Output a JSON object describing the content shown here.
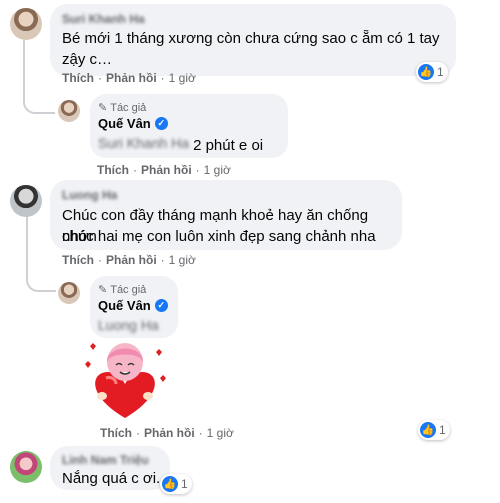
{
  "comments": [
    {
      "author": "Suri Khanh Ha",
      "text_line1": "Bé mới 1 tháng xương còn chưa cứng sao c ẵm có 1 tay",
      "text_line2": "zậy c…",
      "like_label": "Thích",
      "reply_label": "Phản hồi",
      "time": "1 giờ",
      "reaction_count": "1",
      "reply": {
        "badge": "Tác giả",
        "author": "Quế Vân",
        "mention": "Suri Khanh Ha",
        "text": "2 phút e oi",
        "like_label": "Thích",
        "reply_label": "Phản hồi",
        "time": "1 giờ"
      }
    },
    {
      "author": "Luong Ha",
      "text_line1": "Chúc con đầy tháng mạnh khoẻ hay ăn chống nhớn",
      "text_line2": "chúc hai mẹ con luôn xinh đẹp sang chảnh nha",
      "like_label": "Thích",
      "reply_label": "Phản hồi",
      "time": "1 giờ",
      "reply": {
        "badge": "Tác giả",
        "author": "Quế Vân",
        "mention": "Luong Ha",
        "like_label": "Thích",
        "reply_label": "Phản hồi",
        "time": "1 giờ",
        "reaction_count": "1"
      }
    },
    {
      "author": "Linh Nam Triệu",
      "text": "Nắng quá c ơi.",
      "reaction_count": "1"
    }
  ],
  "icons": {
    "like": "like-icon",
    "verified": "verified-icon",
    "author_badge": "pencil-icon",
    "sticker": "heart-hug-sticker"
  },
  "colors": {
    "bubble": "#f0f2f5",
    "like_blue": "#1877f2",
    "secondary_text": "#65676b"
  }
}
